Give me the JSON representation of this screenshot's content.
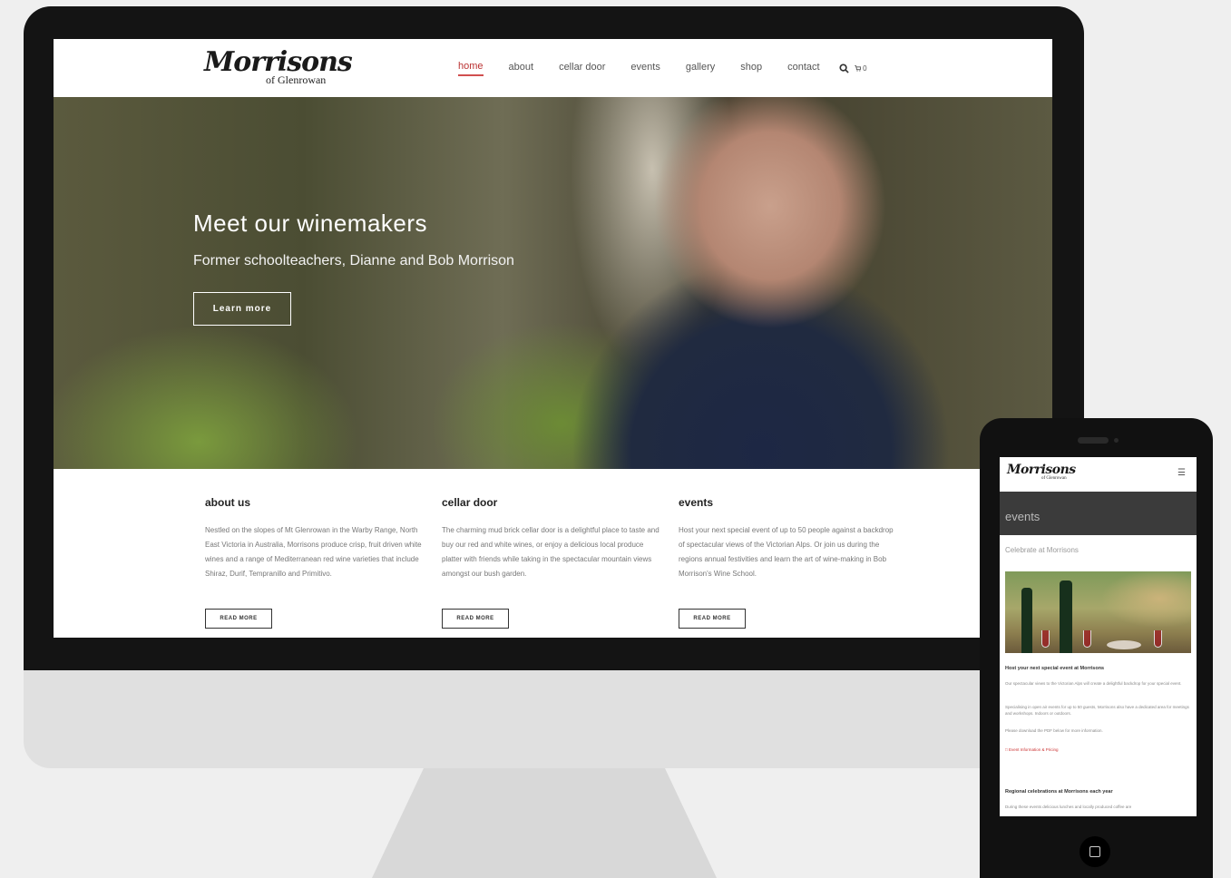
{
  "desktop": {
    "logo": {
      "main": "Morrisons",
      "sub": "of Glenrowan"
    },
    "nav": [
      {
        "label": "home",
        "active": true
      },
      {
        "label": "about",
        "active": false
      },
      {
        "label": "cellar door",
        "active": false
      },
      {
        "label": "events",
        "active": false
      },
      {
        "label": "gallery",
        "active": false
      },
      {
        "label": "shop",
        "active": false
      },
      {
        "label": "contact",
        "active": false
      }
    ],
    "icons": {
      "search": "search-icon",
      "cart": "cart-icon"
    },
    "cart_count": "0",
    "hero": {
      "title": "Meet our winemakers",
      "subtitle": "Former schoolteachers, Dianne and Bob Morrison",
      "button": "Learn more"
    },
    "features": [
      {
        "title": "about us",
        "text": "Nestled on the slopes of Mt Glenrowan in the Warby Range, North East Victoria in Australia, Morrisons produce crisp, fruit driven white wines and a range of Mediterranean red wine varieties that include Shiraz, Durif, Tempranillo and Primitivo.",
        "button": "READ MORE"
      },
      {
        "title": "cellar door",
        "text": "The charming mud brick cellar door is a delightful place to taste and buy our red and white wines, or enjoy a delicious local produce platter with friends while taking in the spectacular mountain views amongst our bush garden.",
        "button": "READ MORE"
      },
      {
        "title": "events",
        "text": "Host your next special event of up to 50 people against a backdrop of spectacular views of the Victorian Alps. Or join us during the regions annual festivities and learn the art of wine-making in Bob Morrison's Wine School.",
        "button": "READ MORE"
      }
    ]
  },
  "mobile": {
    "logo": {
      "main": "Morrisons",
      "sub": "of Glenrowan"
    },
    "menu_icon": "hamburger-icon",
    "banner_title": "events",
    "subtitle": "Celebrate at Morrisons",
    "heading1": "Host your next special event at Morrisons",
    "para1": "Our spectacular views to the Victorian Alps will create a delightful backdrop for your special event.",
    "para2": "Specialising in open air events for up to 50 guests, Morrisons also have a dedicated area for meetings and workshops. Indoors or outdoors.",
    "para3": "Please download the PDF below for more information.",
    "link": "Event Information & Pricing",
    "heading2": "Regional celebrations at Morrisons each year",
    "para4": "During these events delicious lunches and locally produced coffee are"
  },
  "colors": {
    "accent": "#d05050",
    "frame": "#141414",
    "background": "#efefef"
  }
}
